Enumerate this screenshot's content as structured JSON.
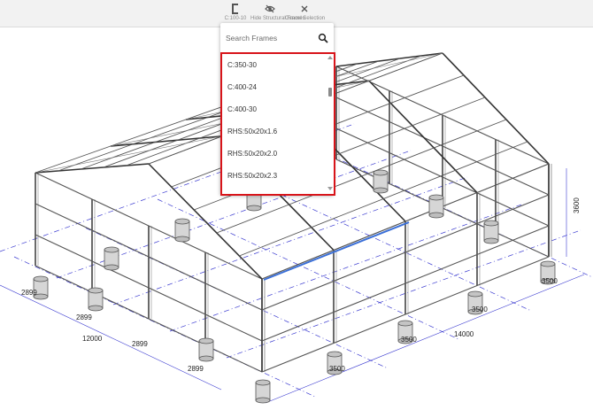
{
  "toolbar": {
    "items": [
      {
        "label": "C:100-10",
        "icon": "c-section-icon"
      },
      {
        "label": "Hide Structural Frames",
        "icon": "eye-off-icon"
      },
      {
        "label": "Cancel Selection",
        "icon": "close-icon"
      }
    ]
  },
  "search": {
    "placeholder": "Search Frames",
    "value": ""
  },
  "frames": [
    {
      "label": "C:350-30"
    },
    {
      "label": "C:400-24"
    },
    {
      "label": "C:400-30"
    },
    {
      "label": "RHS:50x20x1.6"
    },
    {
      "label": "RHS:50x20x2.0"
    },
    {
      "label": "RHS:50x20x2.3"
    }
  ],
  "dimensions": {
    "d1": "2899",
    "d2": "2899",
    "d3": "12000",
    "d4": "2899",
    "d5": "2899",
    "d6": "3500",
    "d7": "3500",
    "d8": "3500",
    "d9": "3500",
    "d10": "14000",
    "d11": "3600"
  },
  "colors": {
    "highlight": "#d8141a",
    "beam_selected": "#3a6fd8",
    "gridline": "#3a3ad0"
  }
}
